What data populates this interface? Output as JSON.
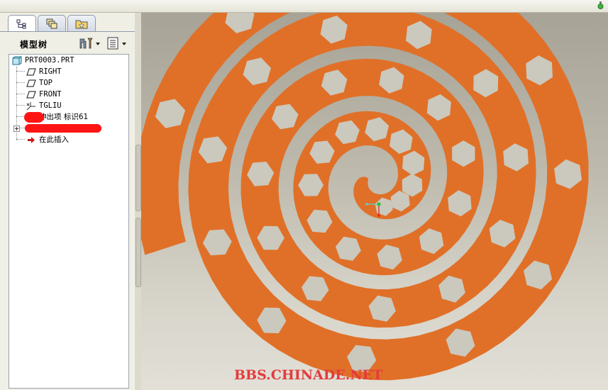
{
  "colors": {
    "part": "#e07028",
    "csys_x": "#5fd0d0",
    "csys_y": "#2fbf2f",
    "csys_z": "#e02020",
    "watermark": "#e33b3b",
    "redact": "#ff1414"
  },
  "tabs": [
    {
      "name": "model-tree-tab",
      "icon": "tree-icon"
    },
    {
      "name": "layers-tab",
      "icon": "layers-icon"
    },
    {
      "name": "favorites-tab",
      "icon": "folder-star-icon"
    }
  ],
  "tree": {
    "title": "模型树",
    "tools_icon": "settings-icon",
    "show_icon": "show-list-icon",
    "items": [
      {
        "label": "PRT0003.PRT",
        "icon": "part-icon"
      },
      {
        "label": "RIGHT",
        "icon": "datum-plane-icon"
      },
      {
        "label": "TOP",
        "icon": "datum-plane-icon"
      },
      {
        "label": "FRONT",
        "icon": "datum-plane-icon"
      },
      {
        "label": "TGLIU",
        "icon": "csys-icon"
      },
      {
        "label": "伸出项 标识61",
        "icon": "protrusion-icon"
      },
      {
        "label": "",
        "icon": "feature-icon"
      },
      {
        "label": "在此插入",
        "icon": "insert-here-arrow-icon"
      }
    ]
  },
  "watermark": "BBS.CHINADE.NET"
}
